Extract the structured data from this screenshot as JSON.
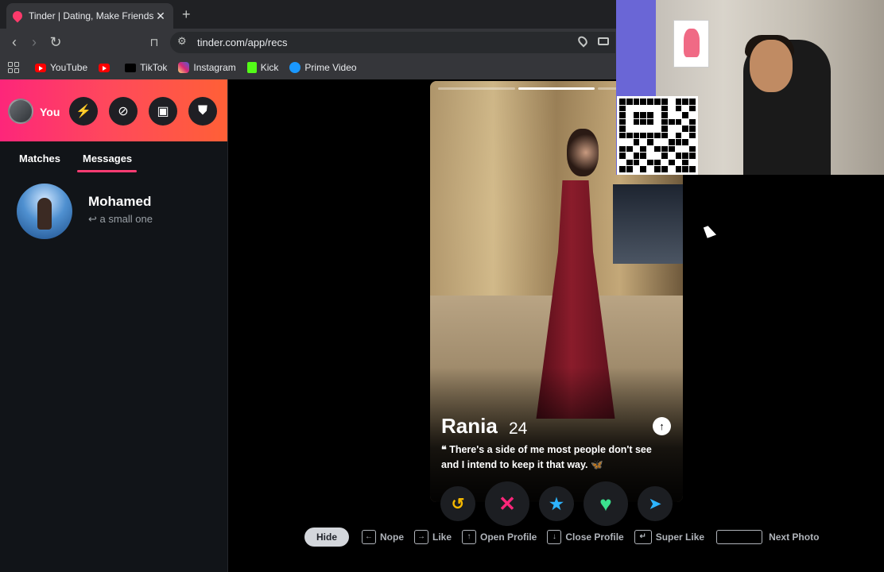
{
  "browser": {
    "tab_title": "Tinder | Dating, Make Friends &",
    "tab_close": "✕",
    "new_tab": "+",
    "url": "tinder.com/app/recs",
    "bookmarks": [
      "YouTube",
      "",
      "TikTok",
      "Instagram",
      "Kick",
      "Prime Video"
    ]
  },
  "sidebar": {
    "me_label": "You",
    "tabs": {
      "matches": "Matches",
      "messages": "Messages"
    },
    "conversation": {
      "name": "Mohamed",
      "preview": "↩ a small one"
    }
  },
  "profile": {
    "name": "Rania",
    "age": "24",
    "bio": "❝ There's a side of me most people don't see and I intend to keep it that way. 🦋",
    "photo_count": 3,
    "active_photo": 2
  },
  "actions": {
    "rewind": "↺",
    "nope": "✕",
    "superlike": "★",
    "like": "♥",
    "boost": "➤"
  },
  "shortcuts": {
    "hide": "Hide",
    "nope": "Nope",
    "like": "Like",
    "open_profile": "Open Profile",
    "close_profile": "Close Profile",
    "super_like": "Super Like",
    "next_photo": "Next Photo"
  },
  "colors": {
    "brand_gradient_start": "#fd267a",
    "brand_gradient_end": "#ff6036",
    "active_tab_underline": "#fe3c72"
  }
}
